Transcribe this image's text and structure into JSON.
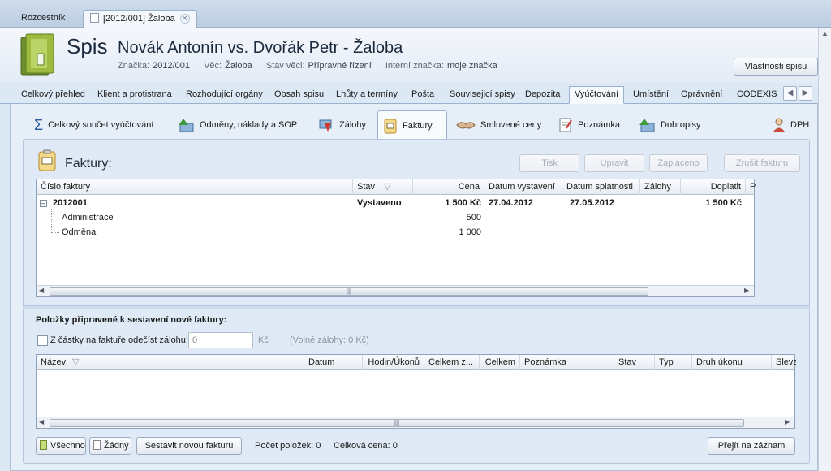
{
  "top_tabs": {
    "home": "Rozcestník",
    "doc": "[2012/001] Žaloba"
  },
  "header": {
    "kind": "Spis",
    "title": "Novák Antonín vs. Dvořák Petr - Žaloba",
    "meta": [
      {
        "label": "Značka:",
        "value": "2012/001"
      },
      {
        "label": "Věc:",
        "value": "Žaloba"
      },
      {
        "label": "Stav věci:",
        "value": "Přípravné řízení"
      },
      {
        "label": "Interní značka:",
        "value": "moje značka"
      }
    ],
    "properties_button": "Vlastnosti spisu"
  },
  "main_tabs": [
    "Celkový přehled",
    "Klient a protistrana",
    "Rozhodující orgány",
    "Obsah spisu",
    "Lhůty a termíny",
    "Pošta",
    "Souvisejicí spisy",
    "Depozita",
    "Vyúčtování",
    "Umístění",
    "Oprávnění",
    "CODEXIS"
  ],
  "sub_tabs": [
    "Celkový součet vyúčtování",
    "Odměny, náklady a SOP",
    "Zálohy",
    "Faktury",
    "Smluvené ceny",
    "Poznámka",
    "Dobropisy",
    "DPH"
  ],
  "faktury": {
    "title": "Faktury:",
    "buttons": {
      "print": "Tisk",
      "edit": "Upravit",
      "paid": "Zaplaceno",
      "cancel": "Zrušit fakturu"
    },
    "columns": [
      "Číslo faktury",
      "Stav",
      "Cena",
      "Datum vystavení",
      "Datum splatnosti",
      "Zálohy",
      "Doplatit",
      "P"
    ],
    "invoice": {
      "number": "2012001",
      "status": "Vystaveno",
      "price": "1 500 Kč",
      "issued": "27.04.2012",
      "due": "27.05.2012",
      "deposits": "",
      "remaining": "1 500 Kč"
    },
    "items": [
      {
        "name": "Administrace",
        "price": "500"
      },
      {
        "name": "Odměna",
        "price": "1 000"
      }
    ]
  },
  "new_invoice": {
    "title": "Položky připravené k sestavení nové faktury:",
    "deduct_label": "Z částky na faktuře odečíst zálohu:",
    "deduct_value": "0",
    "currency": "Kč",
    "free_deposits": "(Volné zálohy: 0 Kč)",
    "columns": [
      "Název",
      "Datum",
      "Hodin/Úkonů",
      "Celkem z...",
      "Celkem",
      "Poznámka",
      "Stav",
      "Typ",
      "Druh úkonu",
      "Sleva"
    ]
  },
  "footer": {
    "all": "Všechno",
    "none": "Žádný",
    "compose": "Sestavit novou fakturu",
    "count": "Počet položek: 0",
    "total": "Celková cena: 0",
    "go_to": "Přejít na záznam"
  }
}
